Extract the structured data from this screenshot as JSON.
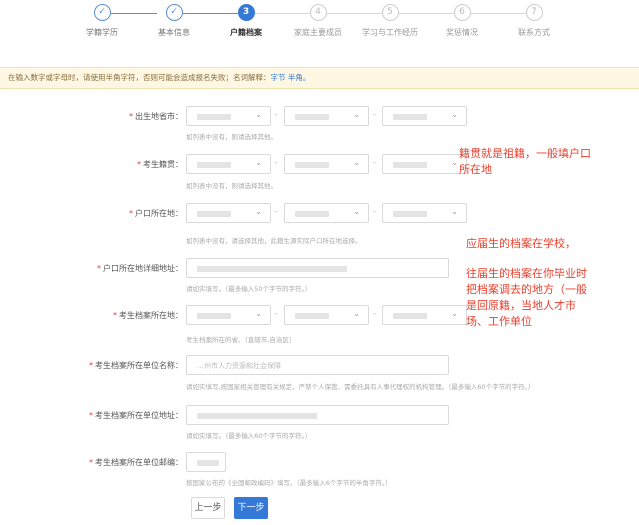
{
  "steps": [
    {
      "num": "✓",
      "label": "学籍学历",
      "state": "done"
    },
    {
      "num": "✓",
      "label": "基本信息",
      "state": "done"
    },
    {
      "num": "3",
      "label": "户籍档案",
      "state": "active"
    },
    {
      "num": "4",
      "label": "家庭主要成员",
      "state": "todo"
    },
    {
      "num": "5",
      "label": "学习与工作经历",
      "state": "todo"
    },
    {
      "num": "6",
      "label": "奖惩情况",
      "state": "todo"
    },
    {
      "num": "7",
      "label": "联系方式",
      "state": "todo"
    }
  ],
  "notice": {
    "text": "在输入数字或字母时，请使用半角字符，否则可能会造成报名失败；名词解释：",
    "link1": "字节",
    "link2": "半角"
  },
  "form": {
    "birthplace": {
      "label": "出生地省市：",
      "hint": "如列表中没有，则请选择其他。"
    },
    "native_place": {
      "label": "考生籍贯：",
      "hint": "如列表中没有，则请选择其他。"
    },
    "hukou": {
      "label": "户口所在地：",
      "hint": "如列表中没有，请选择其他，此籍生源实际户口所在地选择。"
    },
    "hukou_address": {
      "label": "户口所在地详细地址：",
      "hint": "请如实填写。（最多输入50个字节的字符。）"
    },
    "archive_location": {
      "label": "考生档案所在地：",
      "hint": "考生档案所在的省、（直辖市,自治区）"
    },
    "archive_unit": {
      "label": "考生档案所在单位名称：",
      "value": "…州市人力资源和社会保障",
      "hint": "请如实填写,按国家相关管理有关规定，严禁个人保管、需委托具有人事代理权的机构管理。（最多输入60个字节的字符。）"
    },
    "archive_unit_address": {
      "label": "考生档案所在单位地址：",
      "hint": "请如实填写。（最多输入60个字节的字符。）"
    },
    "archive_unit_postcode": {
      "label": "考生档案所在单位邮编：",
      "hint": "按国家公布的《全国邮政编码》填写。（最多输入6个字节的半角字符。）"
    }
  },
  "annotations": {
    "native_place_note_1": "籍贯就是祖籍，一般填户口",
    "native_place_note_2": "所在地",
    "fresh_grad_note": "应届生的档案在学校，",
    "past_grad_note_1": "往届生的档案在你毕业时",
    "past_grad_note_2": "把档案调去的地方（一般",
    "past_grad_note_3": "是回原籍，当地人才市",
    "past_grad_note_4": "场、工作单位"
  },
  "buttons": {
    "prev": "上一步",
    "next": "下一步"
  },
  "colors": {
    "accent": "#3478d8",
    "annotation": "#e8412f",
    "required": "#e04040",
    "notice_bg": "#fdf7e3"
  }
}
